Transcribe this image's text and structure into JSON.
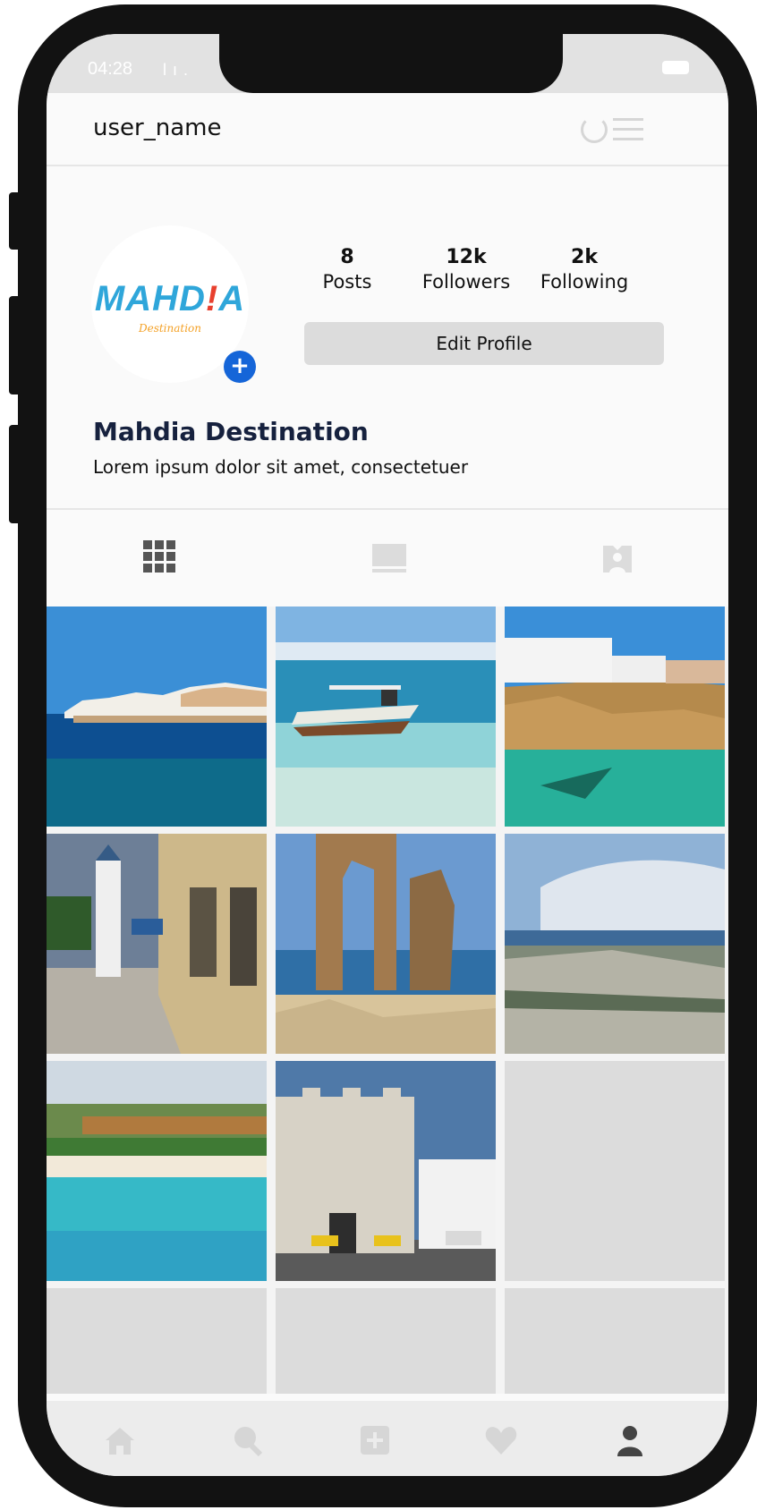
{
  "status": {
    "time": "04:28",
    "signal": "l ı ."
  },
  "header": {
    "username": "user_name"
  },
  "profile": {
    "logo_text": "MAHD",
    "logo_bang": "!",
    "logo_text2": "A",
    "logo_sub": "Destination",
    "stats": [
      {
        "value": "8",
        "label": "Posts"
      },
      {
        "value": "12k",
        "label": "Followers"
      },
      {
        "value": "2k",
        "label": "Following"
      }
    ],
    "edit_button": "Edit Profile",
    "display_name": "Mahdia Destination",
    "bio": "Lorem ipsum dolor sit amet, consectetuer"
  },
  "tabs": [
    "grid-icon",
    "feed-icon",
    "tagged-icon"
  ],
  "posts": [
    {
      "subject": "white town on sea"
    },
    {
      "subject": "boat in clear water"
    },
    {
      "subject": "clifftop house and turquoise cove"
    },
    {
      "subject": "old street with mosque"
    },
    {
      "subject": "ancient stone arch ruins"
    },
    {
      "subject": "rocky coastline"
    },
    {
      "subject": "turquoise beach"
    },
    {
      "subject": "fortress gate"
    },
    {
      "subject": ""
    },
    {
      "subject": ""
    },
    {
      "subject": ""
    },
    {
      "subject": ""
    }
  ],
  "nav": [
    "home-icon",
    "search-icon",
    "add-post-icon",
    "heart-icon",
    "profile-icon"
  ],
  "colors": {
    "accent": "#1565d8",
    "logo_blue": "#2fa6da",
    "logo_red": "#e8402e",
    "logo_orange": "#f4a126"
  }
}
